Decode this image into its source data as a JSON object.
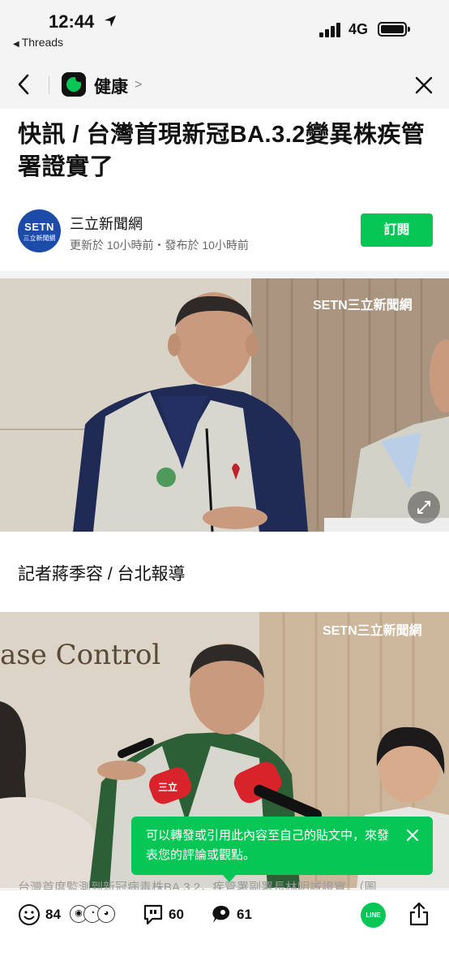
{
  "status_bar": {
    "time": "12:44",
    "back_app": "Threads",
    "network": "4G"
  },
  "nav": {
    "category": "健康"
  },
  "article": {
    "headline": "快訊 / 台灣首現新冠BA.3.2變異株疾管署證實了",
    "publisher": {
      "name": "三立新聞網",
      "logo_text_top": "SETN",
      "logo_text_bottom": "三立新聞網",
      "meta": "更新於 10小時前・發布於 10小時前"
    },
    "subscribe_label": "訂閱",
    "byline": "記者蔣季容 / 台北報導",
    "photo_watermark": "SETN三立新聞網",
    "photo2_sign": "ase Control",
    "photo2_mic_text": "三立",
    "body_snippet": "台灣首度監測到新冠病毒株BA.3.2，疾管署副署長林明誠證實。（圖"
  },
  "tooltip": {
    "text": "可以轉發或引用此內容至自己的貼文中，來發表您的評論或觀點。"
  },
  "bottom_bar": {
    "reactions_count": "84",
    "comments_count": "60",
    "shares_count": "61",
    "line_label": "LINE"
  },
  "colors": {
    "accent_green": "#06c755",
    "publisher_blue": "#1c4ca8"
  }
}
